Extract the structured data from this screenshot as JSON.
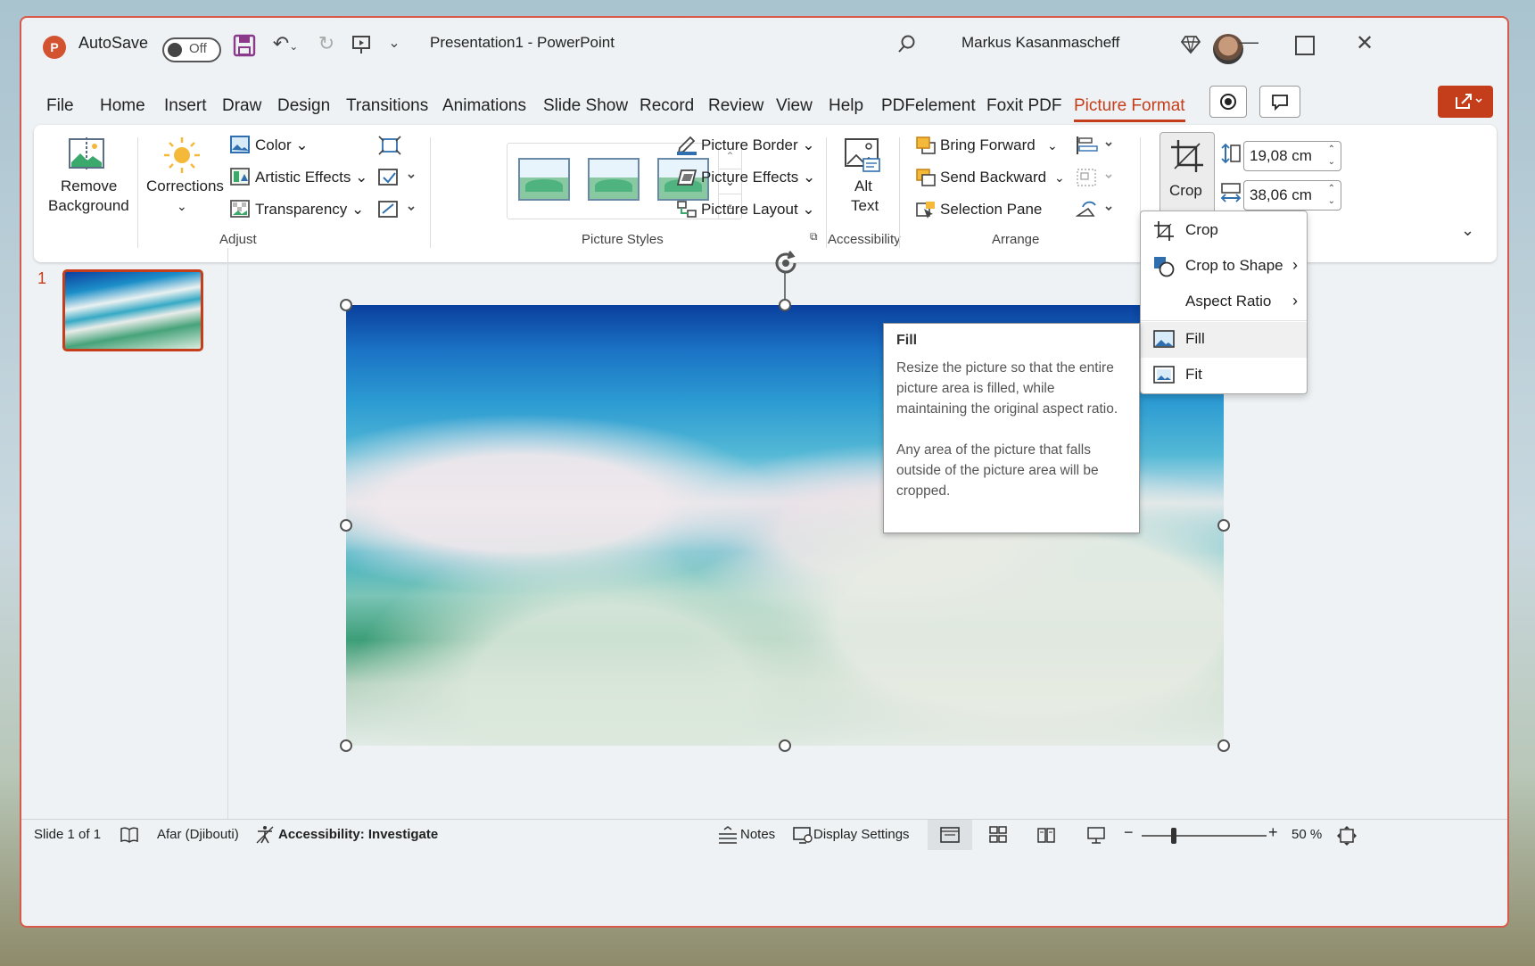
{
  "app": {
    "autosave_label": "AutoSave",
    "autosave_state": "Off",
    "document_title": "Presentation1  -  PowerPoint",
    "user_name": "Markus Kasanmascheff",
    "logo_letter": "P"
  },
  "menu_tabs": [
    "File",
    "Home",
    "Insert",
    "Draw",
    "Design",
    "Transitions",
    "Animations",
    "Slide Show",
    "Record",
    "Review",
    "View",
    "Help",
    "PDFelement",
    "Foxit PDF",
    "Picture Format"
  ],
  "active_tab": "Picture Format",
  "ribbon": {
    "adjust": {
      "remove_background_1": "Remove",
      "remove_background_2": "Background",
      "corrections": "Corrections",
      "color": "Color",
      "artistic_effects": "Artistic Effects",
      "transparency": "Transparency",
      "group_label": "Adjust"
    },
    "picture_styles": {
      "picture_border": "Picture Border",
      "picture_effects": "Picture Effects",
      "picture_layout": "Picture Layout",
      "group_label": "Picture Styles"
    },
    "accessibility": {
      "alt_text_1": "Alt",
      "alt_text_2": "Text",
      "group_label": "Accessibility"
    },
    "arrange": {
      "bring_forward": "Bring Forward",
      "send_backward": "Send Backward",
      "selection_pane": "Selection Pane",
      "group_label": "Arrange"
    },
    "size": {
      "crop_label": "Crop",
      "height": "19,08 cm",
      "width": "38,06 cm"
    }
  },
  "crop_menu": {
    "items": [
      {
        "label": "Crop",
        "icon": "crop-icon",
        "submenu": false
      },
      {
        "label": "Crop to Shape",
        "icon": "crop-to-shape-icon",
        "submenu": true
      },
      {
        "label": "Aspect Ratio",
        "icon": "",
        "submenu": true
      },
      {
        "label": "Fill",
        "icon": "fill-picture-icon",
        "submenu": false
      },
      {
        "label": "Fit",
        "icon": "fit-picture-icon",
        "submenu": false
      }
    ],
    "hovered": "Fill"
  },
  "tooltip": {
    "title": "Fill",
    "paragraph1": "Resize the picture so that the entire picture area is filled, while maintaining the original aspect ratio.",
    "paragraph2": "Any area of the picture that falls outside of the picture area will be cropped."
  },
  "slides": {
    "current_number": "1"
  },
  "status": {
    "slide_info": "Slide 1 of 1",
    "language": "Afar (Djibouti)",
    "accessibility": "Accessibility: Investigate",
    "notes": "Notes",
    "display_settings": "Display Settings",
    "zoom_level": "50 %",
    "zoom_fraction": 0.5
  },
  "colors": {
    "accent": "#c43e1c",
    "window_border": "#d9594a"
  }
}
